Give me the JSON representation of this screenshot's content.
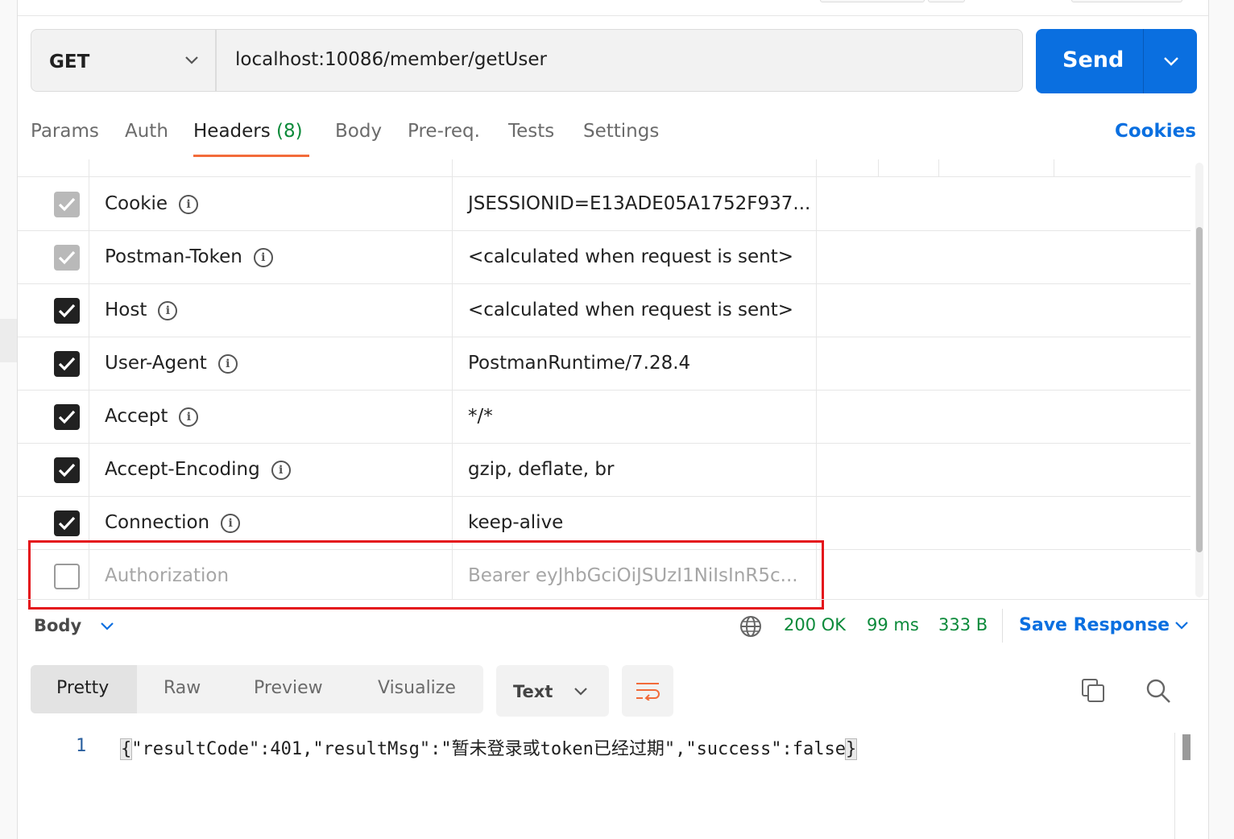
{
  "request": {
    "method": "GET",
    "url": "localhost:10086/member/getUser",
    "send_label": "Send"
  },
  "tabs": {
    "params": "Params",
    "auth": "Auth",
    "headers": "Headers",
    "headers_count": "(8)",
    "body": "Body",
    "prereq": "Pre-req.",
    "tests": "Tests",
    "settings": "Settings",
    "cookies": "Cookies"
  },
  "headers": [
    {
      "key": "Cookie",
      "value": "JSESSIONID=E13ADE05A1752F937...",
      "state": "disabled"
    },
    {
      "key": "Postman-Token",
      "value": "<calculated when request is sent>",
      "state": "disabled"
    },
    {
      "key": "Host",
      "value": "<calculated when request is sent>",
      "state": "checked"
    },
    {
      "key": "User-Agent",
      "value": "PostmanRuntime/7.28.4",
      "state": "checked"
    },
    {
      "key": "Accept",
      "value": "*/*",
      "state": "checked"
    },
    {
      "key": "Accept-Encoding",
      "value": "gzip, deflate, br",
      "state": "checked"
    },
    {
      "key": "Connection",
      "value": "keep-alive",
      "state": "checked"
    },
    {
      "key": "Authorization",
      "value": "Bearer eyJhbGciOiJSUzI1NiIsInR5c...",
      "state": "unchecked"
    }
  ],
  "response": {
    "body_label": "Body",
    "status": "200 OK",
    "time": "99 ms",
    "size": "333 B",
    "save_label": "Save Response",
    "views": {
      "pretty": "Pretty",
      "raw": "Raw",
      "preview": "Preview",
      "visualize": "Visualize"
    },
    "format": "Text",
    "line_number": "1",
    "code_open": "{",
    "code_inner": "\"resultCode\":401,\"resultMsg\":\"暂未登录或token已经过期\",\"success\":false",
    "code_close": "}"
  },
  "colors": {
    "accent": "#0a6fe0",
    "status_ok": "#0c8a3a",
    "active_tab_underline": "#f26b3a",
    "highlight_box": "#e4141b"
  }
}
